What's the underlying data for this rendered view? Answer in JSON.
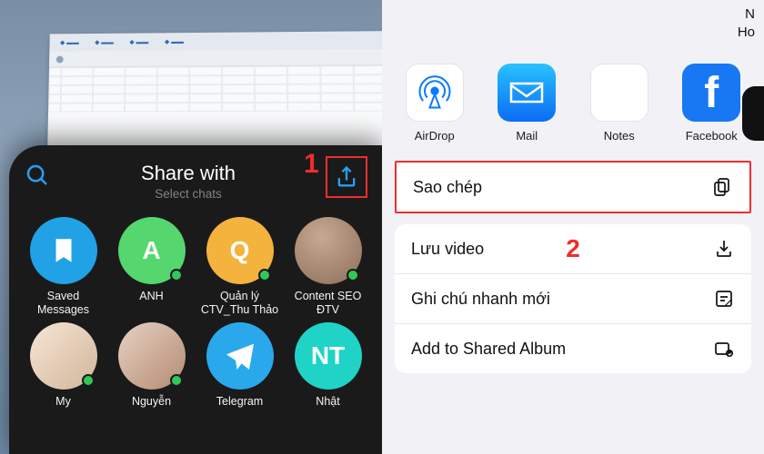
{
  "annotations": {
    "one": "1",
    "two": "2"
  },
  "left": {
    "title": "Share with",
    "subtitle": "Select chats",
    "chats": [
      {
        "label": "Saved Messages"
      },
      {
        "label": "ANH",
        "initial": "A"
      },
      {
        "label": "Quản lý CTV_Thu Thảo",
        "initial": "Q"
      },
      {
        "label": "Content SEO ĐTV"
      },
      {
        "label": "My"
      },
      {
        "label": "Nguyễn"
      },
      {
        "label": "Telegram"
      },
      {
        "label": "Nhật",
        "initial": "NT"
      }
    ]
  },
  "right": {
    "corner": [
      "N",
      "Ho"
    ],
    "apps": [
      {
        "name": "AirDrop"
      },
      {
        "name": "Mail"
      },
      {
        "name": "Notes"
      },
      {
        "name": "Facebook"
      }
    ],
    "actions": {
      "copy": "Sao chép",
      "save_video": "Lưu video",
      "quick_note": "Ghi chú nhanh mới",
      "shared_album": "Add to Shared Album"
    }
  }
}
